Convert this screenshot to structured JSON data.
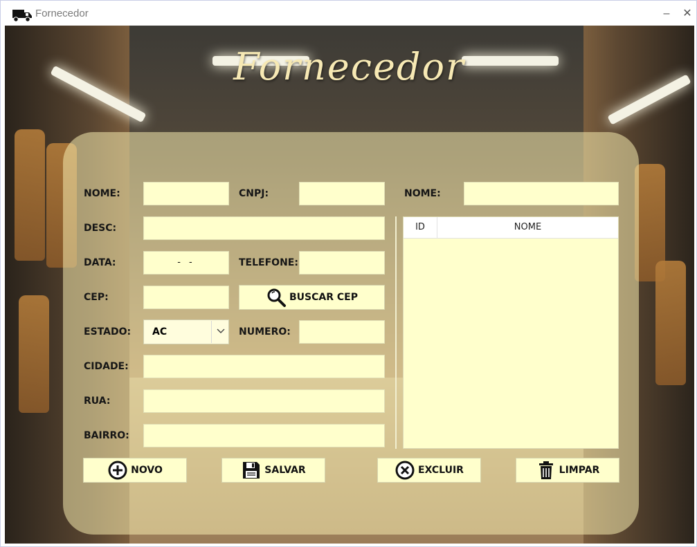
{
  "window": {
    "title": "Fornecedor",
    "minimize_label": "–",
    "close_label": "✕",
    "icon": "truck-icon"
  },
  "page": {
    "heading": "Fornecedor"
  },
  "form": {
    "nome_label": "NOME:",
    "cnpj_label": "CNPJ:",
    "desc_label": "DESC:",
    "data_label": "DATA:",
    "data_mask": "- -",
    "telefone_label": "TELEFONE:",
    "cep_label": "CEP:",
    "buscar_cep_label": "BUSCAR CEP",
    "estado_label": "ESTADO:",
    "estado_value": "AC",
    "numero_label": "NUMERO:",
    "cidade_label": "CIDADE:",
    "rua_label": "RUA:",
    "bairro_label": "BAIRRO:"
  },
  "search": {
    "nome_label": "NOME:"
  },
  "table": {
    "columns": [
      "ID",
      "NOME"
    ],
    "rows": []
  },
  "actions": {
    "novo_label": "NOVO",
    "salvar_label": "SALVAR",
    "excluir_label": "EXCLUIR",
    "limpar_label": "LIMPAR"
  },
  "icons": {
    "buscar": "magnifier-icon",
    "novo": "plus-circle-icon",
    "salvar": "floppy-disk-icon",
    "excluir": "x-circle-icon",
    "limpar": "trash-icon"
  },
  "colors": {
    "field_bg": "#ffffcc",
    "heading": "#f7e9b4",
    "panel": "#f5ebaf"
  }
}
